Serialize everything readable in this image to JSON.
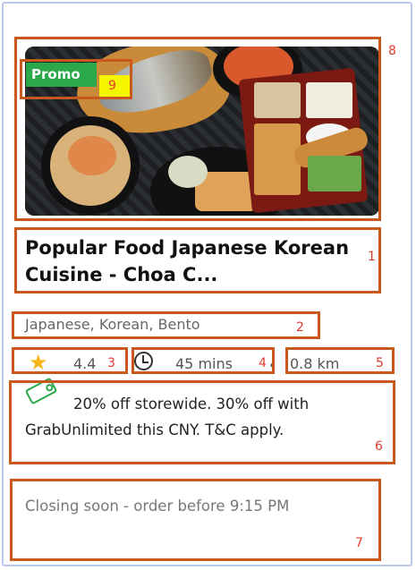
{
  "badge": {
    "label": "Promo"
  },
  "restaurant": {
    "name": "Popular Food Japanese Korean Cuisine - Choa C...",
    "cuisines": "Japanese, Korean, Bento",
    "rating": "4.4",
    "delivery_time": "45 mins",
    "separator": "•",
    "distance": "0.8 km"
  },
  "promotion": {
    "text": "20% off storewide. 30% off with GrabUnlimited this CNY. T&C apply."
  },
  "status": {
    "text": "Closing soon - order before 9:15 PM"
  },
  "annotations": [
    "1",
    "2",
    "3",
    "4",
    "5",
    "6",
    "7",
    "8",
    "9"
  ],
  "icons": {
    "rating": "star-icon",
    "time": "clock-icon",
    "promo": "tag-icon"
  },
  "colors": {
    "promo_badge": "#2aa84a",
    "star": "#f6b61a",
    "annotation_box": "#c8581c",
    "annotation_number": "#e03a2f"
  }
}
